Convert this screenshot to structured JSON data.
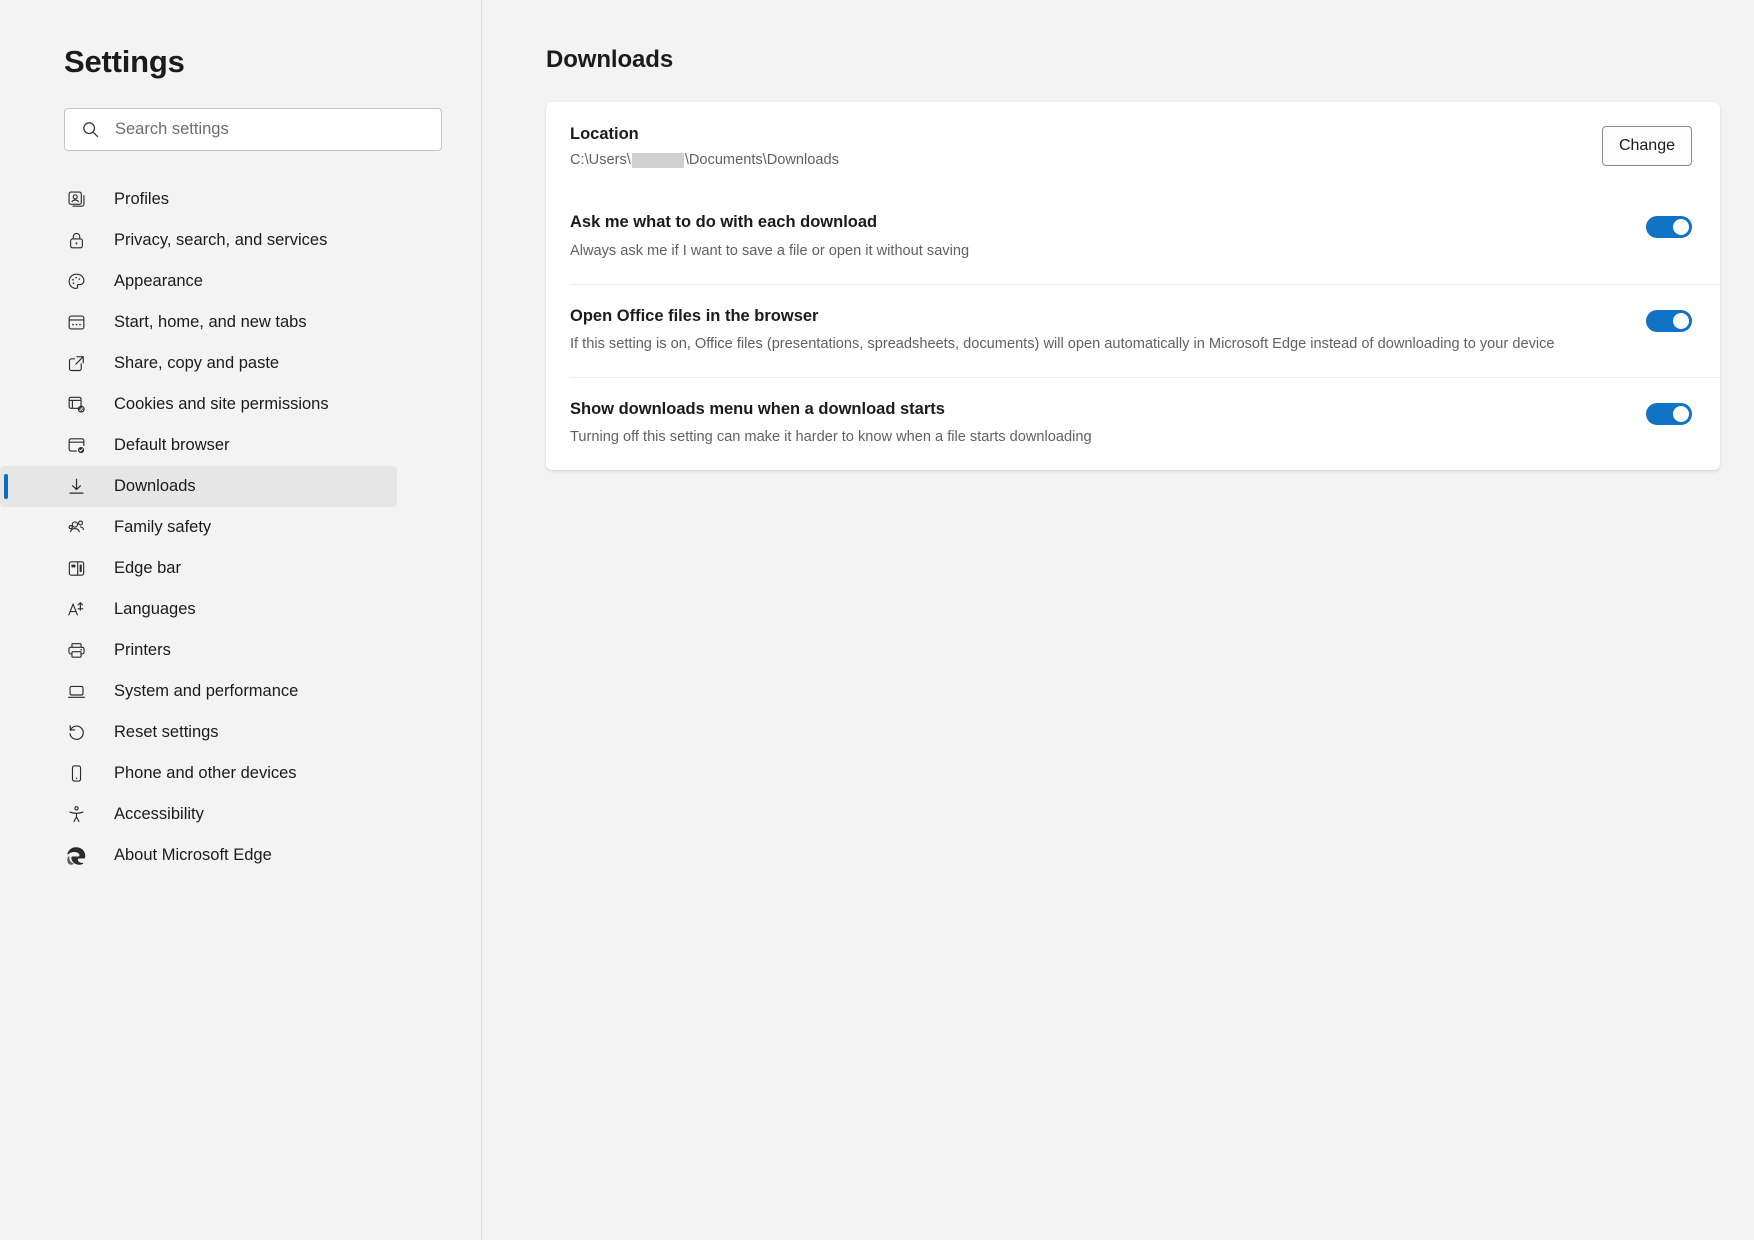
{
  "sidebar": {
    "title": "Settings",
    "search": {
      "placeholder": "Search settings",
      "value": "",
      "icon": "search-icon"
    },
    "items": [
      {
        "label": "Profiles",
        "icon": "profiles-icon",
        "selected": false
      },
      {
        "label": "Privacy, search, and services",
        "icon": "lock-icon",
        "selected": false
      },
      {
        "label": "Appearance",
        "icon": "palette-icon",
        "selected": false
      },
      {
        "label": "Start, home, and new tabs",
        "icon": "window-tabs-icon",
        "selected": false
      },
      {
        "label": "Share, copy and paste",
        "icon": "share-icon",
        "selected": false
      },
      {
        "label": "Cookies and site permissions",
        "icon": "cookie-settings-icon",
        "selected": false
      },
      {
        "label": "Default browser",
        "icon": "browser-check-icon",
        "selected": false
      },
      {
        "label": "Downloads",
        "icon": "download-icon",
        "selected": true
      },
      {
        "label": "Family safety",
        "icon": "people-icon",
        "selected": false
      },
      {
        "label": "Edge bar",
        "icon": "edge-bar-icon",
        "selected": false
      },
      {
        "label": "Languages",
        "icon": "languages-icon",
        "selected": false
      },
      {
        "label": "Printers",
        "icon": "printer-icon",
        "selected": false
      },
      {
        "label": "System and performance",
        "icon": "laptop-icon",
        "selected": false
      },
      {
        "label": "Reset settings",
        "icon": "reset-icon",
        "selected": false
      },
      {
        "label": "Phone and other devices",
        "icon": "phone-icon",
        "selected": false
      },
      {
        "label": "Accessibility",
        "icon": "accessibility-icon",
        "selected": false
      },
      {
        "label": "About Microsoft Edge",
        "icon": "edge-logo-icon",
        "selected": false
      }
    ]
  },
  "main": {
    "page_title": "Downloads",
    "location": {
      "title": "Location",
      "path_prefix": "C:\\Users\\",
      "path_suffix": "\\Documents\\Downloads",
      "redacted": true,
      "change_label": "Change"
    },
    "settings": [
      {
        "title": "Ask me what to do with each download",
        "description": "Always ask me if I want to save a file or open it without saving",
        "toggle_on": true
      },
      {
        "title": "Open Office files in the browser",
        "description": "If this setting is on, Office files (presentations, spreadsheets, documents) will open automatically in Microsoft Edge instead of downloading to your device",
        "toggle_on": true
      },
      {
        "title": "Show downloads menu when a download starts",
        "description": "Turning off this setting can make it harder to know when a file starts downloading",
        "toggle_on": true
      }
    ]
  },
  "colors": {
    "accent": "#0f6cbd",
    "toggle_on": "#1073c6",
    "page_background": "#f3f3f3",
    "card_background": "#ffffff",
    "selected_row": "#e6e6e6"
  }
}
